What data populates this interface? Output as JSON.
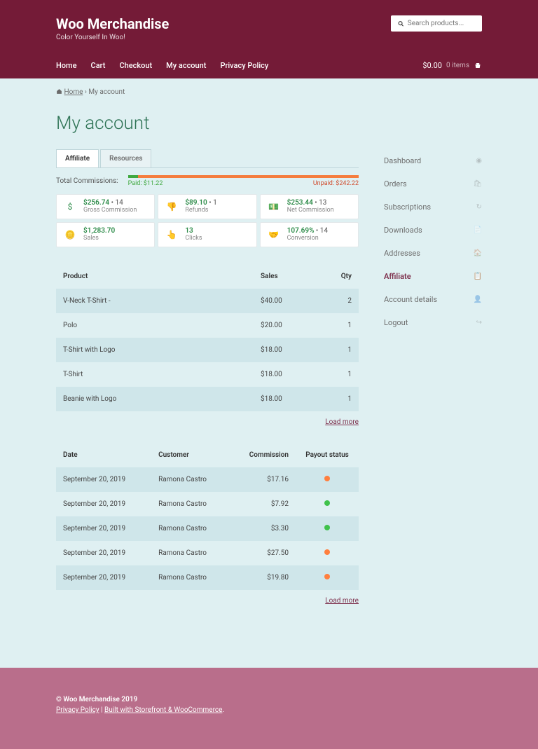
{
  "brand": {
    "title": "Woo Merchandise",
    "tag": "Color Yourself In Woo!"
  },
  "search": {
    "placeholder": "Search products..."
  },
  "nav": {
    "home": "Home",
    "cart": "Cart",
    "checkout": "Checkout",
    "account": "My account",
    "privacy": "Privacy Policy"
  },
  "cart": {
    "amount": "$0.00",
    "items": "0 items"
  },
  "breadcrumb": {
    "home": "Home",
    "current": "My account"
  },
  "page_title": "My account",
  "tabs": {
    "affiliate": "Affiliate",
    "resources": "Resources"
  },
  "commissions": {
    "label": "Total Commissions:",
    "paid_label": "Paid: $11.22",
    "unpaid_label": "Unpaid: $242.22",
    "paid_pct": 4.4,
    "unpaid_pct": 95.6
  },
  "stats": {
    "gross": {
      "val": "$256.74",
      "mult": " • 14",
      "label": "Gross Commission"
    },
    "refunds": {
      "val": "$89.10",
      "mult": " • 1",
      "label": "Refunds"
    },
    "net": {
      "val": "$253.44",
      "mult": " • 13",
      "label": "Net Commission"
    },
    "sales": {
      "val": "$1,283.70",
      "mult": "",
      "label": "Sales"
    },
    "clicks": {
      "val": "13",
      "mult": "",
      "label": "Clicks"
    },
    "conversion": {
      "val": "107.69%",
      "mult": " • 14",
      "label": "Conversion"
    }
  },
  "products_table": {
    "h1": "Product",
    "h2": "Sales",
    "h3": "Qty",
    "rows": [
      {
        "p": "V-Neck T-Shirt -",
        "s": "$40.00",
        "q": "2"
      },
      {
        "p": "Polo",
        "s": "$20.00",
        "q": "1"
      },
      {
        "p": "T-Shirt with Logo",
        "s": "$18.00",
        "q": "1"
      },
      {
        "p": "T-Shirt",
        "s": "$18.00",
        "q": "1"
      },
      {
        "p": "Beanie with Logo",
        "s": "$18.00",
        "q": "1"
      }
    ]
  },
  "load_more": "Load more",
  "commissions_table": {
    "h1": "Date",
    "h2": "Customer",
    "h3": "Commission",
    "h4": "Payout status",
    "rows": [
      {
        "d": "September 20, 2019",
        "c": "Ramona Castro",
        "a": "$17.16",
        "s": "orange"
      },
      {
        "d": "September 20, 2019",
        "c": "Ramona Castro",
        "a": "$7.92",
        "s": "green"
      },
      {
        "d": "September 20, 2019",
        "c": "Ramona Castro",
        "a": "$3.30",
        "s": "green"
      },
      {
        "d": "September 20, 2019",
        "c": "Ramona Castro",
        "a": "$27.50",
        "s": "orange"
      },
      {
        "d": "September 20, 2019",
        "c": "Ramona Castro",
        "a": "$19.80",
        "s": "orange"
      }
    ]
  },
  "sidebar": {
    "dashboard": "Dashboard",
    "orders": "Orders",
    "subscriptions": "Subscriptions",
    "downloads": "Downloads",
    "addresses": "Addresses",
    "affiliate": "Affiliate",
    "account": "Account details",
    "logout": "Logout"
  },
  "footer": {
    "copy": "© Woo Merchandise 2019",
    "privacy": "Privacy Policy",
    "sep": " | ",
    "built": "Built with Storefront & WooCommerce"
  }
}
